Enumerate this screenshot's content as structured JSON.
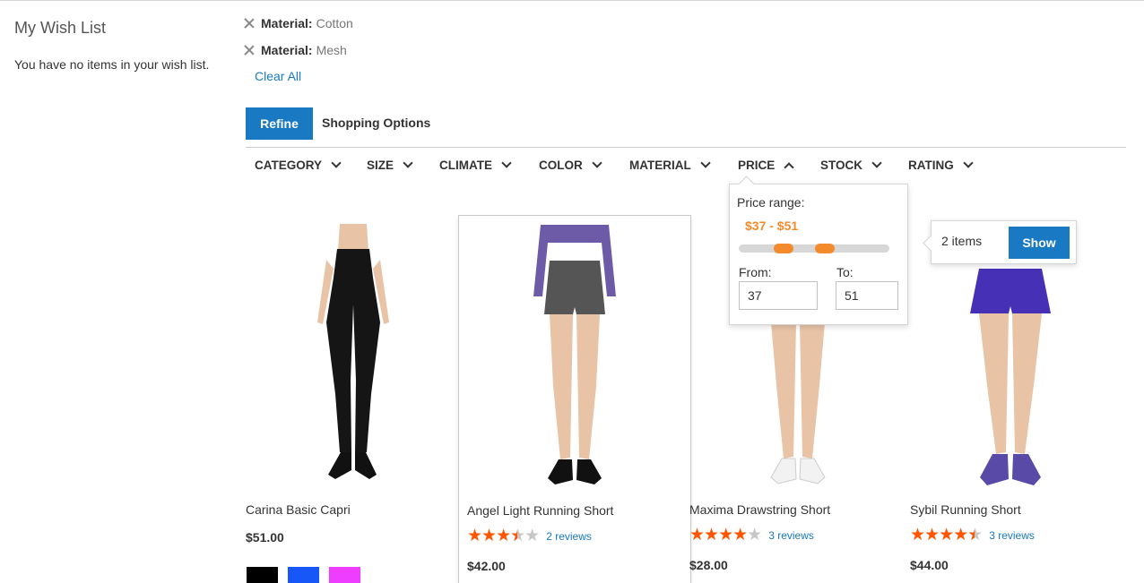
{
  "sidebar": {
    "title": "My Wish List",
    "empty_text": "You have no items in your wish list."
  },
  "active_filters": [
    {
      "label": "Material:",
      "value": "Cotton"
    },
    {
      "label": "Material:",
      "value": "Mesh"
    }
  ],
  "clear_all": "Clear All",
  "tabs": {
    "refine": "Refine",
    "shopping_options": "Shopping Options"
  },
  "attributes": [
    "CATEGORY",
    "SIZE",
    "CLIMATE",
    "COLOR",
    "MATERIAL",
    "PRICE",
    "STOCK",
    "RATING"
  ],
  "price_filter": {
    "label": "Price range:",
    "range": "$37 - $51",
    "from_label": "From:",
    "to_label": "To:",
    "from_value": "37",
    "to_value": "51",
    "min_fraction": 0.3,
    "max_fraction": 0.57
  },
  "show_popup": {
    "items": "2 items",
    "button": "Show"
  },
  "products": [
    {
      "name": "Carina Basic Capri",
      "price": "$51.00",
      "rating": null,
      "reviews": null,
      "swatches": [
        "#000000",
        "#1857f7",
        "#ef3dff"
      ]
    },
    {
      "name": "Angel Light Running Short",
      "price": "$42.00",
      "rating": 3.5,
      "reviews": "2 reviews"
    },
    {
      "name": "Maxima Drawstring Short",
      "price": "$28.00",
      "rating": 4,
      "reviews": "3 reviews"
    },
    {
      "name": "Sybil Running Short",
      "price": "$44.00",
      "rating": 4.5,
      "reviews": "3 reviews"
    }
  ],
  "colors": {
    "primary": "#1979c3",
    "accent": "#f38b2c",
    "star": "#ff5501"
  }
}
